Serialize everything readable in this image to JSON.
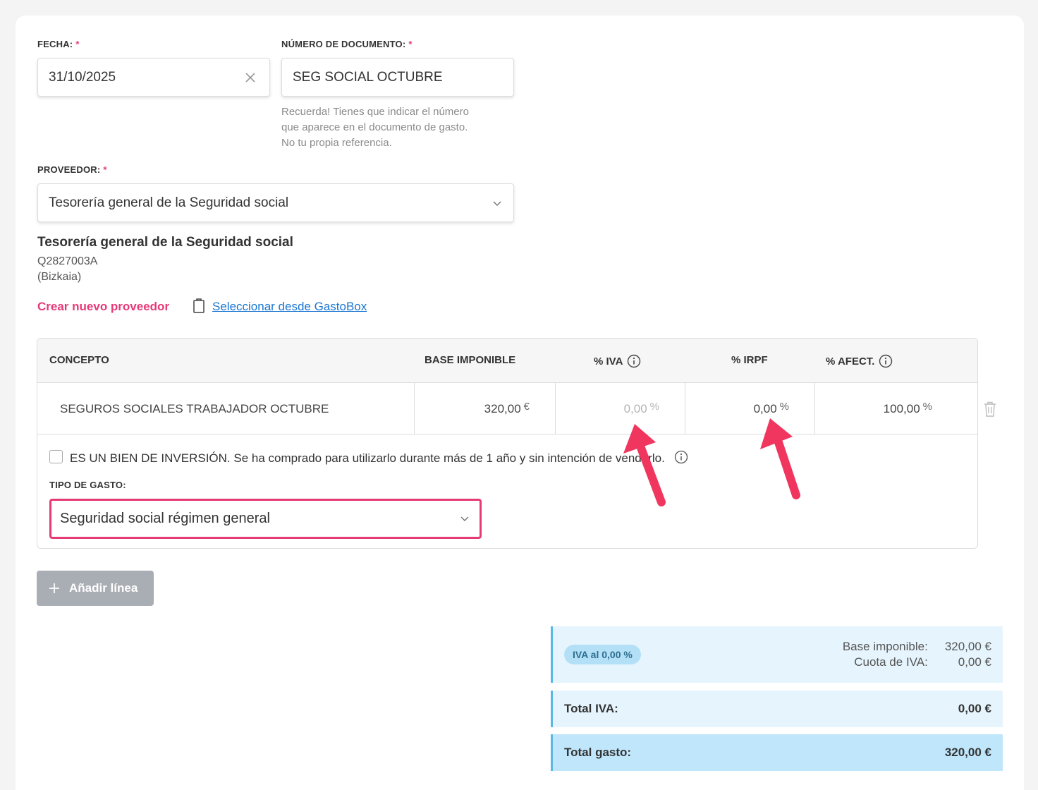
{
  "form": {
    "fecha_label": "FECHA:",
    "fecha_value": "31/10/2025",
    "numero_label": "NÚMERO DE DOCUMENTO:",
    "numero_value": "SEG SOCIAL OCTUBRE",
    "numero_hint_1": "Recuerda! Tienes que indicar el número",
    "numero_hint_2": "que aparece en el documento de gasto.",
    "numero_hint_3": "No tu propia referencia.",
    "proveedor_label": "PROVEEDOR:",
    "proveedor_value": "Tesorería general de la Seguridad social",
    "required_mark": "*"
  },
  "provider": {
    "name": "Tesorería general de la Seguridad social",
    "nif": "Q2827003A",
    "region": "(Bizkaia)",
    "create_link": "Crear nuevo proveedor",
    "select_link": "Seleccionar desde GastoBox"
  },
  "table": {
    "headers": {
      "concepto": "CONCEPTO",
      "base": "BASE IMPONIBLE",
      "iva": "% IVA",
      "irpf": "% IRPF",
      "afect": "% AFECT."
    },
    "row": {
      "concepto": "SEGUROS SOCIALES TRABAJADOR OCTUBRE",
      "base": "320,00",
      "base_unit": "€",
      "iva": "0,00",
      "iva_unit": "%",
      "irpf": "0,00",
      "irpf_unit": "%",
      "afect": "100,00",
      "afect_unit": "%"
    },
    "inversion_text": "ES UN BIEN DE INVERSIÓN. Se ha comprado para utilizarlo durante más de 1 año y sin intención de venderlo.",
    "tipo_label": "TIPO DE GASTO:",
    "tipo_value": "Seguridad social régimen general"
  },
  "add_line_label": "Añadir línea",
  "summary": {
    "pill": "IVA al 0,00 %",
    "base_label": "Base imponible:",
    "base_value": "320,00 €",
    "cuota_label": "Cuota de IVA:",
    "cuota_value": "0,00 €",
    "total_iva_label": "Total IVA:",
    "total_iva_value": "0,00 €",
    "total_gasto_label": "Total gasto:",
    "total_gasto_value": "320,00 €"
  },
  "colors": {
    "accent_pink": "#e63a77",
    "link_blue": "#1976d2",
    "summary_light": "#e6f5fd",
    "summary_total": "#bfe6fb",
    "arrow": "#f0365f"
  },
  "icons": [
    "clear-icon",
    "chevron-down-icon",
    "clipboard-icon",
    "info-icon",
    "trash-icon",
    "plus-icon"
  ]
}
